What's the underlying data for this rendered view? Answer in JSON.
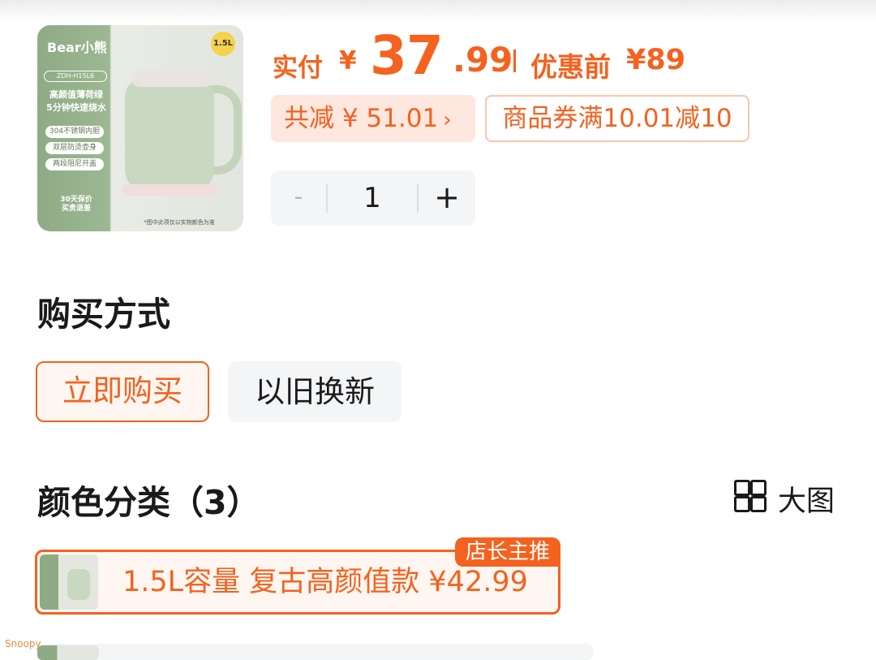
{
  "product": {
    "thumb": {
      "brand": "Bear小熊",
      "model": "ZDH-H15L6",
      "slogan_line1": "高颜值薄荷绿",
      "slogan_line2": "5分钟快速烧水",
      "features": [
        "304不锈钢内胆",
        "双层防烫壶身",
        "两段阻尼开盖"
      ],
      "badge_line1": "30天保价",
      "badge_line2": "买贵退差",
      "capacity": "1.5L",
      "footnote": "*图中此项仅以实物颜色为准"
    }
  },
  "price": {
    "paid_label": "实付",
    "currency": "¥",
    "integer": "37",
    "decimal": ".99",
    "before_label": "优惠前",
    "before_value": "¥89",
    "reduce_label": "共减 ¥ 51.01",
    "reduce_chevron": "›",
    "coupon": "商品券满10.01减10"
  },
  "quantity": {
    "minus": "-",
    "value": "1",
    "plus": "+"
  },
  "purchase_method": {
    "title": "购买方式",
    "options": [
      "立即购买",
      "以旧换新"
    ],
    "selected": "立即购买"
  },
  "color_section": {
    "title": "颜色分类（3）",
    "big_view_label": "大图",
    "options": [
      {
        "label": "1.5L容量 复古高颜值款  ¥42.99",
        "tag": "店长主推",
        "selected": true
      }
    ]
  },
  "watermark": "Snoopy",
  "colors": {
    "accent": "#f4621f",
    "accent_bg": "#fff6f1",
    "chip_bg": "#f4f5f7"
  }
}
